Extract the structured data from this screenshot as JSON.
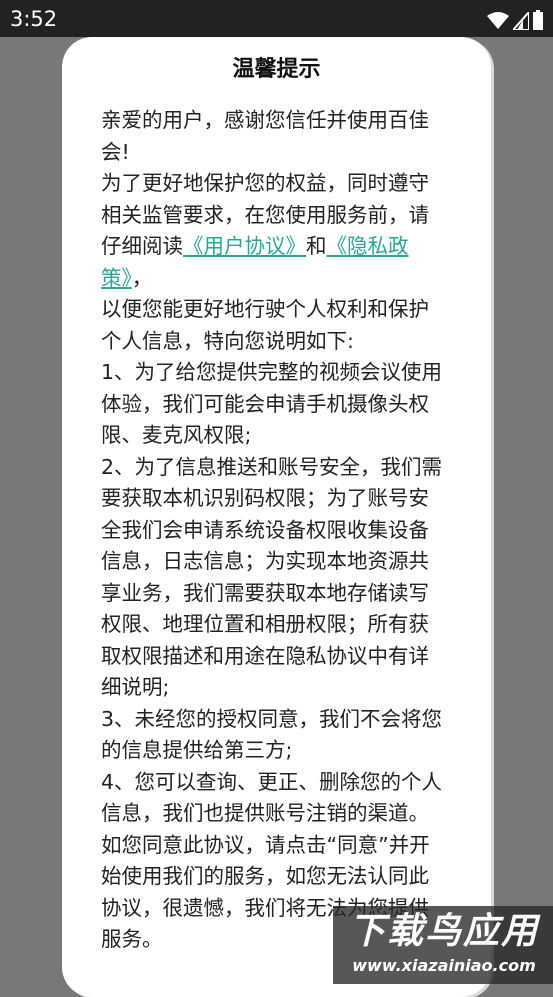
{
  "status_bar": {
    "time": "3:52"
  },
  "dialog": {
    "title": "温馨提示",
    "greeting": "亲爱的用户，感谢您信任并使用百佳会!",
    "intro_before": "为了更好地保护您的权益，同时遵守相关监管要求，在您使用服务前，请仔细阅读",
    "user_agreement_link": "《用户协议》",
    "and_text": "和",
    "privacy_policy_link": "《隐私政策》",
    "intro_after": "，",
    "purpose": "以便您能更好地行驶个人权利和保护个人信息，特向您说明如下:",
    "item1": "1、为了给您提供完整的视频会议使用体验，我们可能会申请手机摄像头权限、麦克风权限;",
    "item2": "2、为了信息推送和账号安全，我们需要获取本机识别码权限；为了账号安全我们会申请系统设备权限收集设备信息，日志信息；为实现本地资源共享业务，我们需要获取本地存储读写权限、地理位置和相册权限；所有获取权限描述和用途在隐私协议中有详细说明;",
    "item3": "3、未经您的授权同意，我们不会将您的信息提供给第三方;",
    "item4": "4、您可以查询、更正、删除您的个人信息，我们也提供账号注销的渠道。",
    "closing": "如您同意此协议，请点击“同意”并开始使用我们的服务，如您无法认同此协议，很遗憾，我们将无法为您提供服务。"
  },
  "watermark": {
    "title": "下载鸟应用",
    "url": "www.xiazainiao.com"
  },
  "colors": {
    "link": "#2ba59b",
    "overlay": "#787878",
    "status_bar": "#222222"
  }
}
